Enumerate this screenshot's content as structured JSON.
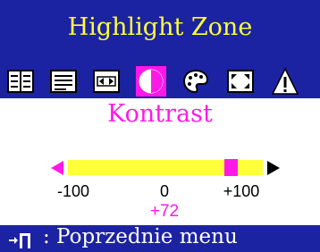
{
  "osd": {
    "title": "Highlight Zone",
    "colors": {
      "background": "#1c23a2",
      "accent": "#ff18e8",
      "title": "#ffff3a",
      "bar": "#ffff3a"
    }
  },
  "icons": [
    {
      "name": "position-grid-icon",
      "selected": false
    },
    {
      "name": "list-text-icon",
      "selected": false
    },
    {
      "name": "size-arrows-icon",
      "selected": false
    },
    {
      "name": "contrast-icon",
      "selected": true
    },
    {
      "name": "palette-icon",
      "selected": false
    },
    {
      "name": "fullscreen-icon",
      "selected": false
    },
    {
      "name": "warning-triangle-icon",
      "selected": false
    }
  ],
  "panel": {
    "label": "Kontrast",
    "scale": {
      "min_label": "-100",
      "mid_label": "0",
      "max_label": "+100"
    },
    "slider": {
      "min": -100,
      "max": 100,
      "value": 72
    },
    "value_text": "+72"
  },
  "footer": {
    "text": ": Poprzednie menu",
    "icon": "exit-door-icon"
  }
}
